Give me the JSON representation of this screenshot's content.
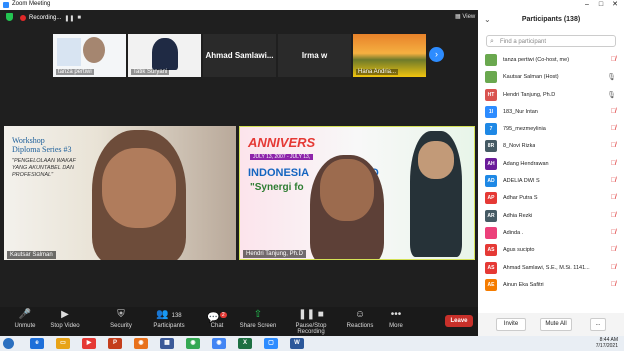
{
  "window": {
    "title": "Zoom Meeting",
    "controls": [
      "–",
      "□",
      "✕"
    ]
  },
  "topbar": {
    "recording_label": "Recording...",
    "pause": "❚❚",
    "stop": "■",
    "view_label": "View"
  },
  "thumbnails": [
    {
      "name": "tanza pertiwi",
      "big_name": ""
    },
    {
      "name": "Tatik Suryani",
      "big_name": ""
    },
    {
      "name": "",
      "big_name": "Ahmad Samlawi..."
    },
    {
      "name": "",
      "big_name": "Irma w"
    },
    {
      "name": "Hana Andria...",
      "big_name": ""
    }
  ],
  "videos": [
    {
      "label": "Kautsar Salman",
      "banner_title": "Workshop Diploma Series #3",
      "banner_text": "\"PENGELOLAAN WAKAF YANG AKUNTABEL DAN PROFESIONAL\""
    },
    {
      "label": "Hendri Tanjung, Ph.D",
      "banner_title": "ANNIVERS",
      "banner_line2": "INDONESIA",
      "banner_line3": "\"Synergi fo",
      "banner_right": "ARD",
      "banner_dates": "JULY 13, 2007 - JULY 13,"
    }
  ],
  "toolbar": {
    "items": [
      {
        "label": "Unmute",
        "icon": "mic-muted-icon",
        "glyph": "🎤"
      },
      {
        "label": "Stop Video",
        "icon": "video-icon",
        "glyph": "▶"
      },
      {
        "label": "Security",
        "icon": "shield-icon",
        "glyph": "⛨"
      },
      {
        "label": "Participants",
        "icon": "participants-icon",
        "glyph": "👥",
        "count": "138"
      },
      {
        "label": "Chat",
        "icon": "chat-icon",
        "glyph": "💬",
        "badge": "2"
      },
      {
        "label": "Share Screen",
        "icon": "share-screen-icon",
        "glyph": "⇧"
      },
      {
        "label": "Pause/Stop Recording",
        "icon": "recording-icon",
        "glyph": "❚❚ ■"
      },
      {
        "label": "Reactions",
        "icon": "reactions-icon",
        "glyph": "☺"
      },
      {
        "label": "More",
        "icon": "more-icon",
        "glyph": "•••"
      }
    ],
    "leave_label": "Leave"
  },
  "participants_panel": {
    "title": "Participants (138)",
    "search_placeholder": "Find a participant",
    "list": [
      {
        "initials": "",
        "name": "tanza pertiwi (Co-host, me)",
        "color": "#6aa84f",
        "mic": "muted"
      },
      {
        "initials": "",
        "name": "Kautsar Salman (Host)",
        "color": "#6aa84f",
        "mic": "on"
      },
      {
        "initials": "HT",
        "name": "Hendri Tanjung, Ph.D",
        "color": "#d9534f",
        "mic": "on"
      },
      {
        "initials": "1I",
        "name": "183_Nur Intan",
        "color": "#2d8cff",
        "mic": "muted"
      },
      {
        "initials": "7",
        "name": "795_mezmeylinia",
        "color": "#1e88e5",
        "mic": "muted"
      },
      {
        "initials": "8R",
        "name": "8_Novi Rizka",
        "color": "#455a64",
        "mic": "muted"
      },
      {
        "initials": "AH",
        "name": "Adang Hendrawan",
        "color": "#6a1b9a",
        "mic": "muted"
      },
      {
        "initials": "AD",
        "name": "ADELIA DWI S",
        "color": "#1e88e5",
        "mic": "muted"
      },
      {
        "initials": "AP",
        "name": "Adhar Putra S",
        "color": "#e53935",
        "mic": "muted"
      },
      {
        "initials": "AR",
        "name": "Adhia Rezki",
        "color": "#455a64",
        "mic": "muted"
      },
      {
        "initials": "",
        "name": "Adinda .",
        "color": "#ec407a",
        "mic": "muted"
      },
      {
        "initials": "AS",
        "name": "Agus sucipto",
        "color": "#e53935",
        "mic": "muted"
      },
      {
        "initials": "AS",
        "name": "Ahmad Samlawi, S.E., M.Si. 1141...",
        "color": "#e53935",
        "mic": "muted"
      },
      {
        "initials": "AE",
        "name": "Ainun Eka Safitri",
        "color": "#f57c00",
        "mic": "muted"
      }
    ],
    "invite_label": "Invite",
    "mute_all_label": "Mute All",
    "more_label": "..."
  },
  "taskbar": {
    "apps": [
      {
        "glyph": "e",
        "color": "#1e6fd9"
      },
      {
        "glyph": "▭",
        "color": "#e8a317"
      },
      {
        "glyph": "▶",
        "color": "#e53935"
      },
      {
        "glyph": "P",
        "color": "#c43e1c"
      },
      {
        "glyph": "◉",
        "color": "#e8711c"
      },
      {
        "glyph": "▦",
        "color": "#3b5998"
      },
      {
        "glyph": "◉",
        "color": "#34a853"
      },
      {
        "glyph": "◉",
        "color": "#4285f4"
      },
      {
        "glyph": "X",
        "color": "#1d6f42"
      },
      {
        "glyph": "▢",
        "color": "#2d8cff"
      },
      {
        "glyph": "W",
        "color": "#2b579a"
      }
    ],
    "time": "8:44 AM",
    "date": "7/17/2021"
  }
}
